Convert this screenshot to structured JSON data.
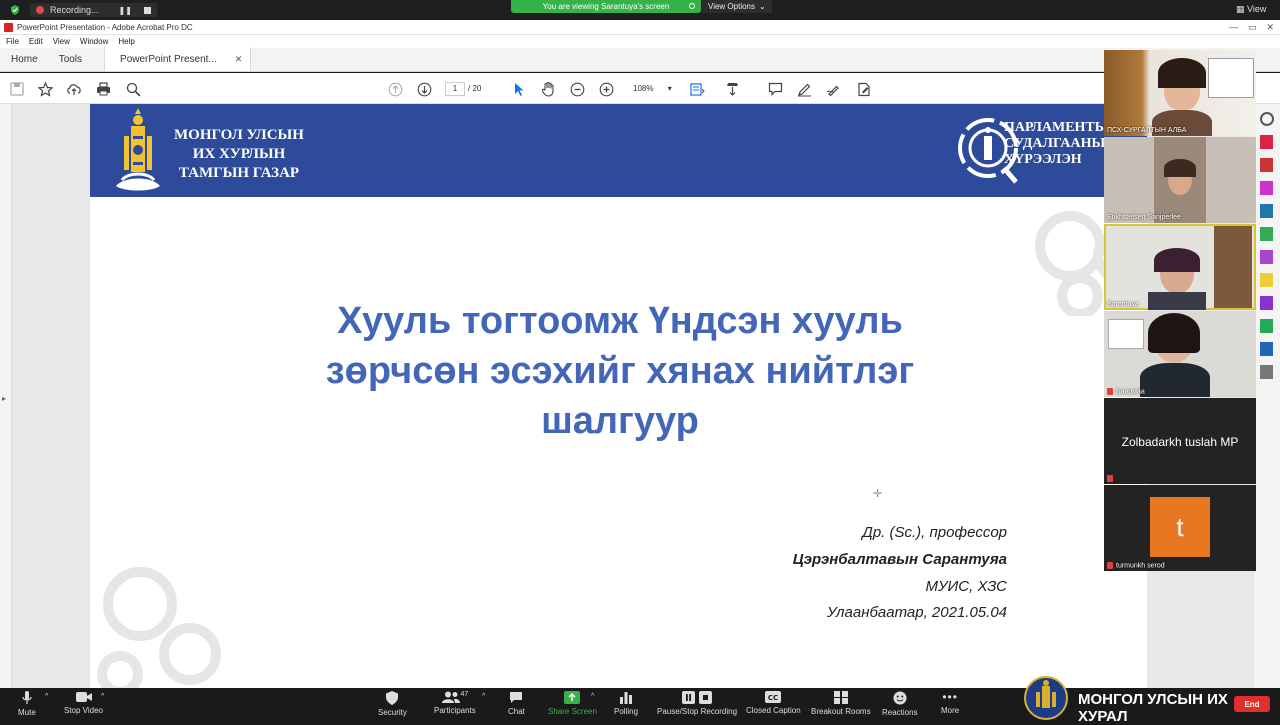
{
  "zoom": {
    "recording_label": "Recording...",
    "share_banner": "You are viewing Sarantuya's screen",
    "view_options": "View Options",
    "view_label": "View"
  },
  "acrobat": {
    "window_title": "PowerPoint Presentation - Adobe Acrobat Pro DC",
    "menu": [
      "File",
      "Edit",
      "View",
      "Window",
      "Help"
    ],
    "tabs": {
      "home": "Home",
      "tools": "Tools",
      "doc": "PowerPoint Present..."
    },
    "page_current": "1",
    "page_total": "/ 20",
    "zoom_level": "108%"
  },
  "slide": {
    "org_left": [
      "МОНГОЛ УЛСЫН",
      "ИХ ХУРЛЫН",
      "ТАМГЫН ГАЗАР"
    ],
    "org_right": [
      "ПАРЛАМЕНТЫ",
      "СУДАЛГААНЫ",
      "ХҮРЭЭЛЭН"
    ],
    "title": [
      "Хууль тогтоомж Үндсэн хууль",
      "зөрчсөн эсэхийг хянах нийтлэг",
      "шалгуур"
    ],
    "author_title": "Др. (Sc.), профессор",
    "author_name": "Цэрэнбалтавын Сарантуяа",
    "affiliation": "МУИС, ХЗС",
    "place_date": "Улаанбаатар, 2021.05.04"
  },
  "participants": [
    {
      "name": "ПСХ-СУРГАЛТЫН АЛБА",
      "muted": false,
      "active": false
    },
    {
      "name": "Enkhtsetseg Sanjperlee",
      "muted": false,
      "active": false
    },
    {
      "name": "Sarantuya",
      "muted": false,
      "active": true
    },
    {
      "name": "Баярмаа",
      "muted": true,
      "active": false
    },
    {
      "name": "Zolbadarkh tuslah MP",
      "muted": true,
      "active": false
    },
    {
      "name": "turmunkh serod",
      "muted": true,
      "active": false,
      "initial": "t"
    }
  ],
  "toolbar": {
    "mute": "Mute",
    "stop_video": "Stop Video",
    "security": "Security",
    "participants": "Participants",
    "participants_count": "47",
    "chat": "Chat",
    "share_screen": "Share Screen",
    "polling": "Polling",
    "pause_recording": "Pause/Stop Recording",
    "closed_caption": "Closed Caption",
    "breakout_rooms": "Breakout Rooms",
    "reactions": "Reactions",
    "more": "More",
    "end": "End"
  },
  "bottom_brand": "МОНГОЛ УЛСЫН ИХ ХУРАЛ",
  "colors": {
    "slide_header": "#2d4a9b",
    "title_blue": "#4466b8",
    "zoom_green": "#35b24a",
    "end_red": "#e02f2f",
    "active_outline": "#d8c436",
    "participant_orange": "#e87722"
  }
}
